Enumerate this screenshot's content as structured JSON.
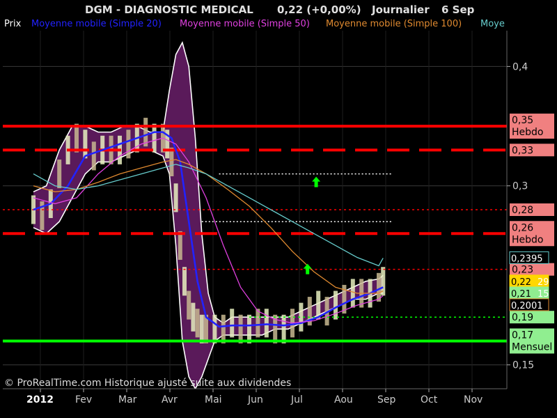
{
  "header": {
    "title": "DGM - DIAGNOSTIC MEDICAL",
    "quote": "0,22 (+0,00%)",
    "period": "Journalier",
    "date": "6 Sep"
  },
  "legend": {
    "items": [
      {
        "label": "Prix",
        "color": "#ffffff"
      },
      {
        "label": "Moyenne mobile (Simple 20)",
        "color": "#2222ff"
      },
      {
        "label": "Moyenne mobile (Simple 50)",
        "color": "#e040e0"
      },
      {
        "label": "Moyenne mobile (Simple 100)",
        "color": "#e08a30"
      },
      {
        "label": "Moye",
        "color": "#66cccc"
      }
    ]
  },
  "copyright": "© ProRealTime.com Historique ajusté suite aux dividendes",
  "colors": {
    "background": "#000000",
    "band": "#5a1a5a",
    "price_up": "#e8f0c0",
    "price_down": "#c8b890",
    "ma20": "#2222ff",
    "ma50": "#e040e0",
    "ma100": "#e08a30",
    "ma200": "#66cccc",
    "resistance": "#ff0000",
    "support": "#00ff00",
    "white_line": "#ffffff",
    "arrow": "#00ff00",
    "grid": "#3a3a3a",
    "axis_text": "#cccccc",
    "label_red_bg": "#f08080",
    "label_green_bg": "#90ee90",
    "label_yellow_bg": "#ffd700"
  },
  "chart_data": {
    "type": "line",
    "y_axis": {
      "ylim": [
        0.13,
        0.43
      ],
      "ticks": [
        "0,4",
        "0,3",
        "0,15"
      ],
      "tick_values": [
        0.4,
        0.3,
        0.15
      ]
    },
    "x_axis": {
      "labels": [
        "2012",
        "Fev",
        "Mar",
        "Avr",
        "Mai",
        "Jun",
        "Jul",
        "Aou",
        "Sep",
        "Oct",
        "Nov"
      ],
      "months": [
        0,
        1,
        2,
        3,
        4,
        5,
        6,
        7,
        8,
        9,
        10
      ],
      "xlim": [
        0,
        11
      ]
    },
    "price": {
      "x": [
        0,
        0.2,
        0.4,
        0.6,
        0.8,
        1.0,
        1.2,
        1.4,
        1.6,
        1.8,
        2.0,
        2.2,
        2.4,
        2.6,
        2.8,
        3.0,
        3.1,
        3.2,
        3.3,
        3.4,
        3.5,
        3.6,
        3.7,
        3.8,
        3.9,
        4.0,
        4.2,
        4.4,
        4.6,
        4.8,
        5.0,
        5.2,
        5.4,
        5.6,
        5.8,
        6.0,
        6.2,
        6.4,
        6.6,
        6.8,
        7.0,
        7.2,
        7.4,
        7.6,
        7.8,
        8.0,
        8.1
      ],
      "y": [
        0.28,
        0.275,
        0.285,
        0.31,
        0.33,
        0.34,
        0.335,
        0.325,
        0.33,
        0.33,
        0.33,
        0.335,
        0.34,
        0.345,
        0.34,
        0.34,
        0.335,
        0.32,
        0.29,
        0.25,
        0.22,
        0.2,
        0.19,
        0.185,
        0.18,
        0.18,
        0.18,
        0.18,
        0.185,
        0.18,
        0.18,
        0.185,
        0.185,
        0.18,
        0.18,
        0.185,
        0.19,
        0.195,
        0.2,
        0.195,
        0.2,
        0.205,
        0.21,
        0.21,
        0.21,
        0.215,
        0.22
      ]
    },
    "bollinger": {
      "x": [
        0,
        0.3,
        0.6,
        0.9,
        1.2,
        1.5,
        1.8,
        2.1,
        2.4,
        2.7,
        3.0,
        3.15,
        3.3,
        3.45,
        3.6,
        3.75,
        3.9,
        4.05,
        4.2,
        4.4,
        4.6,
        4.8,
        5.0,
        5.3,
        5.6,
        5.9,
        6.2,
        6.5,
        6.8,
        7.1,
        7.4,
        7.7,
        8.0,
        8.1
      ],
      "upper": [
        0.295,
        0.3,
        0.33,
        0.35,
        0.35,
        0.345,
        0.345,
        0.35,
        0.35,
        0.345,
        0.345,
        0.38,
        0.41,
        0.42,
        0.4,
        0.34,
        0.26,
        0.21,
        0.19,
        0.185,
        0.19,
        0.19,
        0.19,
        0.19,
        0.19,
        0.19,
        0.195,
        0.2,
        0.205,
        0.21,
        0.215,
        0.22,
        0.222,
        0.225
      ],
      "lower": [
        0.265,
        0.26,
        0.27,
        0.29,
        0.31,
        0.32,
        0.32,
        0.325,
        0.33,
        0.33,
        0.325,
        0.31,
        0.25,
        0.17,
        0.14,
        0.13,
        0.14,
        0.155,
        0.17,
        0.175,
        0.175,
        0.175,
        0.175,
        0.175,
        0.18,
        0.18,
        0.185,
        0.19,
        0.195,
        0.2,
        0.205,
        0.205,
        0.21,
        0.21
      ]
    },
    "series": [
      {
        "name": "Moyenne mobile (Simple 20)",
        "color_key": "ma20",
        "x": [
          0,
          0.4,
          0.8,
          1.2,
          1.6,
          2.0,
          2.4,
          2.8,
          3.0,
          3.2,
          3.4,
          3.6,
          3.8,
          4.0,
          4.3,
          4.6,
          5.0,
          5.4,
          5.8,
          6.2,
          6.6,
          7.0,
          7.4,
          7.8,
          8.1
        ],
        "y": [
          0.28,
          0.285,
          0.3,
          0.325,
          0.33,
          0.335,
          0.34,
          0.345,
          0.345,
          0.34,
          0.32,
          0.27,
          0.22,
          0.19,
          0.182,
          0.183,
          0.183,
          0.184,
          0.183,
          0.185,
          0.19,
          0.198,
          0.205,
          0.21,
          0.215
        ]
      },
      {
        "name": "Moyenne mobile (Simple 50)",
        "color_key": "ma50",
        "x": [
          0,
          0.5,
          1.0,
          1.5,
          2.0,
          2.5,
          3.0,
          3.3,
          3.6,
          4.0,
          4.4,
          4.8,
          5.2,
          5.6,
          6.0,
          6.5,
          7.0,
          7.5,
          8.0,
          8.1
        ],
        "y": [
          0.29,
          0.285,
          0.29,
          0.31,
          0.325,
          0.335,
          0.34,
          0.335,
          0.32,
          0.29,
          0.25,
          0.215,
          0.195,
          0.188,
          0.185,
          0.187,
          0.193,
          0.2,
          0.205,
          0.208
        ]
      },
      {
        "name": "Moyenne mobile (Simple 100)",
        "color_key": "ma100",
        "x": [
          0,
          0.5,
          1.0,
          1.5,
          2.0,
          2.5,
          3.0,
          3.3,
          3.6,
          4.0,
          4.5,
          5.0,
          5.5,
          6.0,
          6.5,
          7.0,
          7.5,
          8.0,
          8.1
        ],
        "y": [
          0.3,
          0.295,
          0.297,
          0.303,
          0.31,
          0.315,
          0.32,
          0.322,
          0.318,
          0.31,
          0.297,
          0.283,
          0.265,
          0.245,
          0.228,
          0.215,
          0.21,
          0.21,
          0.212
        ]
      },
      {
        "name": "Moye",
        "color_key": "ma200",
        "x": [
          0,
          0.5,
          1.0,
          1.5,
          2.0,
          2.5,
          3.0,
          3.3,
          3.6,
          4.0,
          4.5,
          5.0,
          5.5,
          6.0,
          6.5,
          7.0,
          7.5,
          8.0,
          8.1
        ],
        "y": [
          0.31,
          0.3,
          0.297,
          0.3,
          0.305,
          0.31,
          0.315,
          0.318,
          0.315,
          0.31,
          0.3,
          0.29,
          0.28,
          0.27,
          0.26,
          0.25,
          0.24,
          0.233,
          0.2395
        ]
      }
    ],
    "levels": [
      {
        "value": 0.35,
        "style": "solid",
        "color_key": "resistance",
        "label": "0,35",
        "sublabel": "Hebdo",
        "bg": "label_red_bg"
      },
      {
        "value": 0.33,
        "style": "dashed",
        "color_key": "resistance",
        "label": "0,33",
        "sublabel": "",
        "bg": "label_red_bg"
      },
      {
        "value": 0.28,
        "style": "dotted",
        "color_key": "resistance",
        "label": "0,28",
        "sublabel": "",
        "bg": "label_red_bg"
      },
      {
        "value": 0.26,
        "style": "dashed",
        "color_key": "resistance",
        "label": "0,26",
        "sublabel": "Hebdo",
        "bg": "label_red_bg"
      },
      {
        "value": 0.23,
        "style": "dotted",
        "color_key": "resistance",
        "label": "0,23",
        "sublabel": "",
        "bg": "label_red_bg",
        "x_from": 3.25
      },
      {
        "value": 0.19,
        "style": "dotted",
        "color_key": "support",
        "label": "0,19",
        "sublabel": "",
        "bg": "label_green_bg",
        "x_from": 5.0
      },
      {
        "value": 0.17,
        "style": "solid",
        "color_key": "support",
        "label": "0,17",
        "sublabel": "Mensuel",
        "bg": "label_green_bg"
      }
    ],
    "white_segments": [
      {
        "value": 0.31,
        "x_from": 4.3,
        "x_to": 8.3
      },
      {
        "value": 0.27,
        "x_from": 3.9,
        "x_to": 8.3
      }
    ],
    "arrows": [
      {
        "x": 6.55,
        "y": 0.303
      },
      {
        "x": 6.35,
        "y": 0.23
      }
    ],
    "value_labels": [
      {
        "text": "0,2395",
        "value": 0.2395,
        "fg": "#ffffff",
        "bg": "#000000",
        "border": "#66cccc"
      },
      {
        "text": "0,22",
        "value": 0.22,
        "fg": "#000000",
        "bg": "#ffd700",
        "border": "#ffd700",
        "suffix": "29"
      },
      {
        "text": "0,21",
        "value": 0.21,
        "fg": "#000000",
        "bg": "#90ee90",
        "border": "#90ee90",
        "suffix": "15"
      },
      {
        "text": "0,2001",
        "value": 0.2001,
        "fg": "#ffffff",
        "bg": "#000000",
        "border": "#e08a30"
      }
    ]
  }
}
